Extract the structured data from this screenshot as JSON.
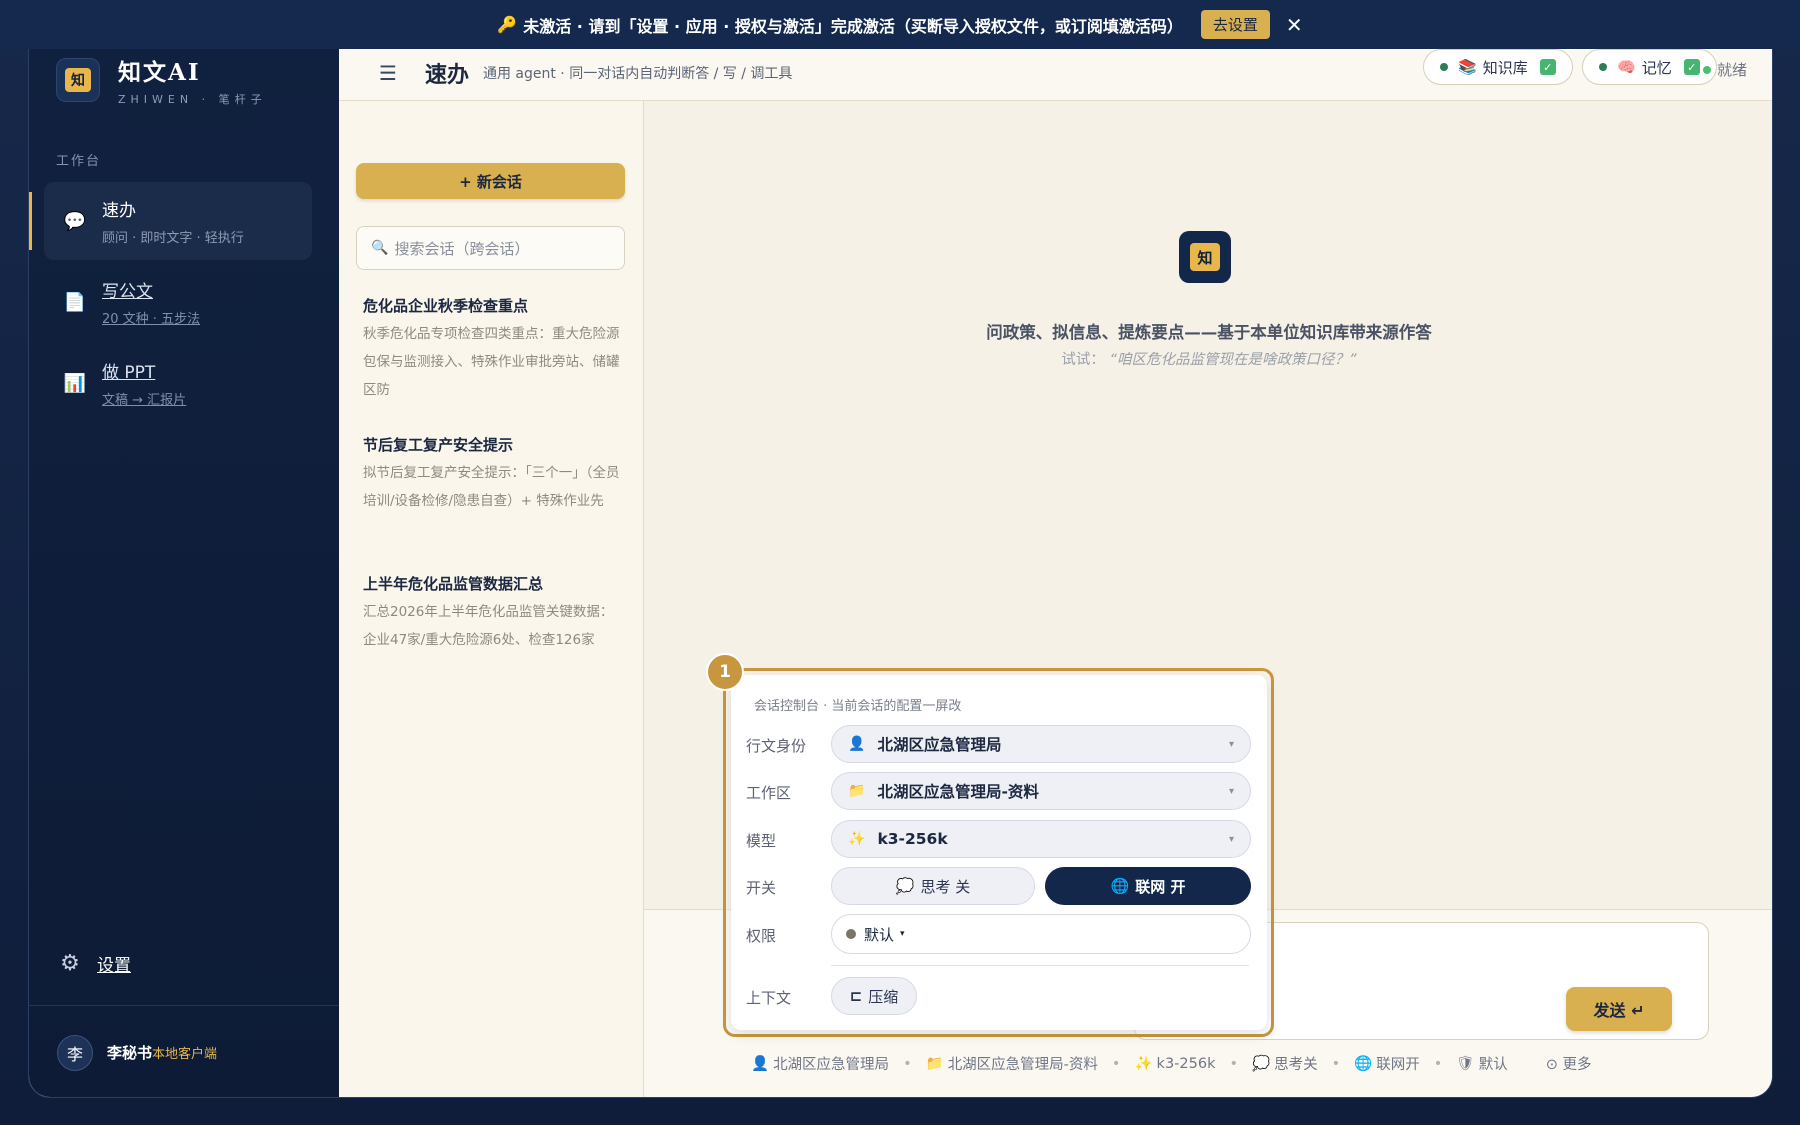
{
  "banner": {
    "key_icon": "🔑",
    "message": "未激活 · 请到「设置 · 应用 · 授权与激活」完成激活（买断导入授权文件，或订阅填激活码）",
    "action_label": "去设置",
    "close_glyph": "✕"
  },
  "brand": {
    "logo_char": "知",
    "name": "知文AI",
    "subtitle": "ZHIWEN · 笔杆子"
  },
  "sidebar": {
    "section_label": "工作台",
    "items": [
      {
        "icon": "💬",
        "title": "速办",
        "subtitle": "顾问 · 即时文字 · 轻执行"
      },
      {
        "icon": "📄",
        "title": "写公文",
        "subtitle": "20 文种 · 五步法"
      },
      {
        "icon": "📊",
        "title": "做 PPT",
        "subtitle": "文稿 → 汇报片"
      }
    ],
    "settings_icon": "⚙",
    "settings_label": "设置",
    "user": {
      "avatar": "李",
      "name": "李秘书",
      "tag": "本地客户端"
    }
  },
  "header": {
    "menu_glyph": "☰",
    "title": "速办",
    "subtitle": "通用 agent · 同一对话内自动判断答 / 写 / 调工具",
    "knowledge_icon": "📚",
    "knowledge_label": "知识库",
    "memory_icon": "🧠",
    "memory_label": "记忆",
    "check_glyph": "✓",
    "status": "就绪"
  },
  "conversations": {
    "new_label": "+ 新会话",
    "search_icon": "🔍",
    "search_placeholder": "搜索会话（跨会话）",
    "items": [
      {
        "title": "危化品企业秋季检查重点",
        "snippet": "秋季危化品专项检查四类重点：重大危险源包保与监测接入、特殊作业审批旁站、储罐区防"
      },
      {
        "title": "节后复工复产安全提示",
        "snippet": "拟节后复工复产安全提示：「三个一」（全员培训/设备检修/隐患自查）+ 特殊作业先"
      },
      {
        "title": "上半年危化品监管数据汇总",
        "snippet": "汇总2026年上半年危化品监管关键数据：企业47家/重大危险源6处、检查126家"
      }
    ]
  },
  "welcome": {
    "logo_char": "知",
    "title": "问政策、拟信息、提炼要点——基于本单位知识库带来源作答",
    "try_prefix": "试试：",
    "try_example": "“咱区危化品监管现在是啥政策口径？”"
  },
  "panel": {
    "badge": "1",
    "heading": "会话控制台 · 当前会话的配置一屏改",
    "identity_label": "行文身份",
    "identity_icon": "👤",
    "identity_value": "北湖区应急管理局",
    "workspace_label": "工作区",
    "workspace_icon": "📁",
    "workspace_value": "北湖区应急管理局-资料",
    "model_label": "模型",
    "model_icon": "✨",
    "model_value": "k3-256k",
    "caret": "▾",
    "switch_label": "开关",
    "think_icon": "💭",
    "think_label": "思考 关",
    "web_icon": "🌐",
    "web_label": "联网 开",
    "perm_label": "权限",
    "perm_value": "默认",
    "context_label": "上下文",
    "compress_icon": "⊏",
    "compress_label": "压缩"
  },
  "composer": {
    "send_label": "发送 ↵"
  },
  "status_strip": {
    "identity_icon": "👤",
    "identity": "北湖区应急管理局",
    "workspace_icon": "📁",
    "workspace": "北湖区应急管理局-资料",
    "model_icon": "✨",
    "model": "k3-256k",
    "think_icon": "💭",
    "think": "思考关",
    "web_icon": "🌐",
    "web": "联网开",
    "perm_icon": "🛡",
    "perm": "默认",
    "more": "⊙ 更多",
    "sep": "•"
  }
}
